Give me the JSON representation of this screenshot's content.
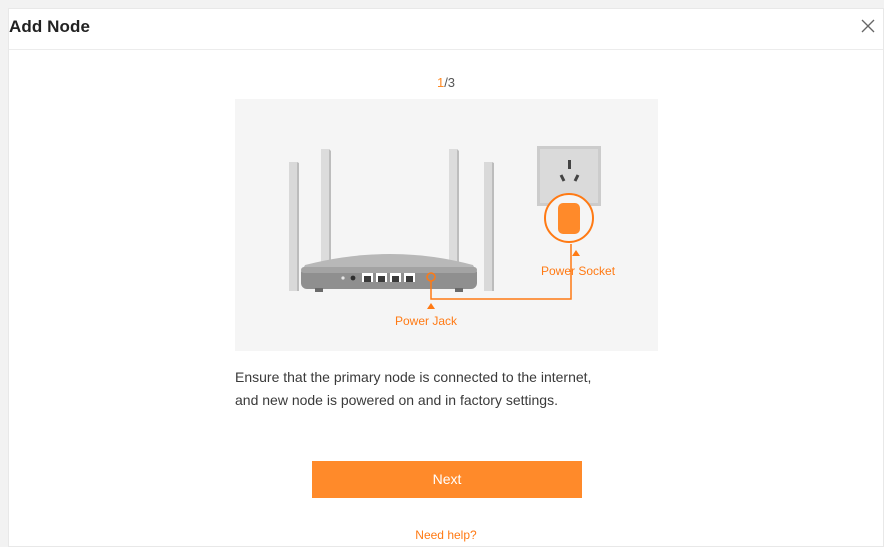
{
  "dialog": {
    "title": "Add Node",
    "close_icon": "close-icon"
  },
  "step": {
    "current": "1",
    "total": "/3"
  },
  "illustration": {
    "power_socket_label": "Power Socket",
    "power_jack_label": "Power Jack",
    "accent_color": "#ff7a14"
  },
  "description": {
    "line1": "Ensure that the primary node is connected to the internet,",
    "line2": "and new node is powered on and in factory settings."
  },
  "actions": {
    "next_label": "Next",
    "help_label": "Need help?"
  },
  "colors": {
    "accent": "#ff8a2a",
    "panel_bg": "#f5f5f5"
  }
}
